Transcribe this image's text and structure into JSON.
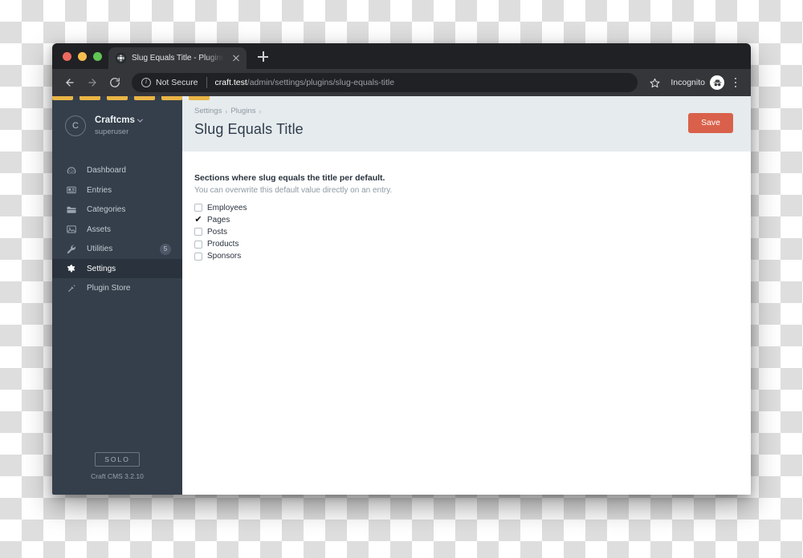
{
  "browser": {
    "traffic_lights": [
      "close",
      "minimize",
      "maximize"
    ],
    "tab": {
      "title": "Slug Equals Title - Plugins - Cr",
      "favicon": "globe-icon",
      "close_icon": "close-icon"
    },
    "new_tab_label": "+",
    "nav": {
      "back_icon": "back-arrow-icon",
      "forward_icon": "forward-arrow-icon",
      "reload_icon": "reload-icon"
    },
    "omnibox": {
      "security_icon": "info-circle-icon",
      "security_label": "Not Secure",
      "url_host": "craft.test",
      "url_path": "/admin/settings/plugins/slug-equals-title"
    },
    "star_icon": "star-icon",
    "incognito_label": "Incognito",
    "incognito_icon": "incognito-icon",
    "menu_icon": "three-dot-menu-icon"
  },
  "sidebar": {
    "account": {
      "avatar_initial": "C",
      "name": "Craftcms",
      "role": "superuser",
      "chevron_icon": "chevron-down-icon"
    },
    "items": [
      {
        "label": "Dashboard",
        "icon": "gauge-icon",
        "active": false,
        "badge": ""
      },
      {
        "label": "Entries",
        "icon": "article-icon",
        "active": false,
        "badge": ""
      },
      {
        "label": "Categories",
        "icon": "folder-icon",
        "active": false,
        "badge": ""
      },
      {
        "label": "Assets",
        "icon": "image-icon",
        "active": false,
        "badge": ""
      },
      {
        "label": "Utilities",
        "icon": "wrench-icon",
        "active": false,
        "badge": "5"
      },
      {
        "label": "Settings",
        "icon": "gear-icon",
        "active": true,
        "badge": ""
      },
      {
        "label": "Plugin Store",
        "icon": "plug-icon",
        "active": false,
        "badge": ""
      }
    ],
    "footer": {
      "edition": "SOLO",
      "version": "Craft CMS 3.2.10"
    }
  },
  "main": {
    "breadcrumb": [
      {
        "label": "Settings",
        "sep": "›"
      },
      {
        "label": "Plugins",
        "sep": "›"
      }
    ],
    "title": "Slug Equals Title",
    "save_label": "Save",
    "field": {
      "heading": "Sections where slug equals the title per default.",
      "instructions": "You can overwrite this default value directly on an entry.",
      "options": [
        {
          "label": "Employees",
          "checked": false
        },
        {
          "label": "Pages",
          "checked": true
        },
        {
          "label": "Posts",
          "checked": false
        },
        {
          "label": "Products",
          "checked": false
        },
        {
          "label": "Sponsors",
          "checked": false
        }
      ]
    }
  },
  "colors": {
    "sidebar_bg": "#343f4b",
    "sidebar_active": "#2a333d",
    "header_bg": "#e6ebee",
    "save_button": "#d9614b",
    "bookmark_folder": "#eab545"
  }
}
